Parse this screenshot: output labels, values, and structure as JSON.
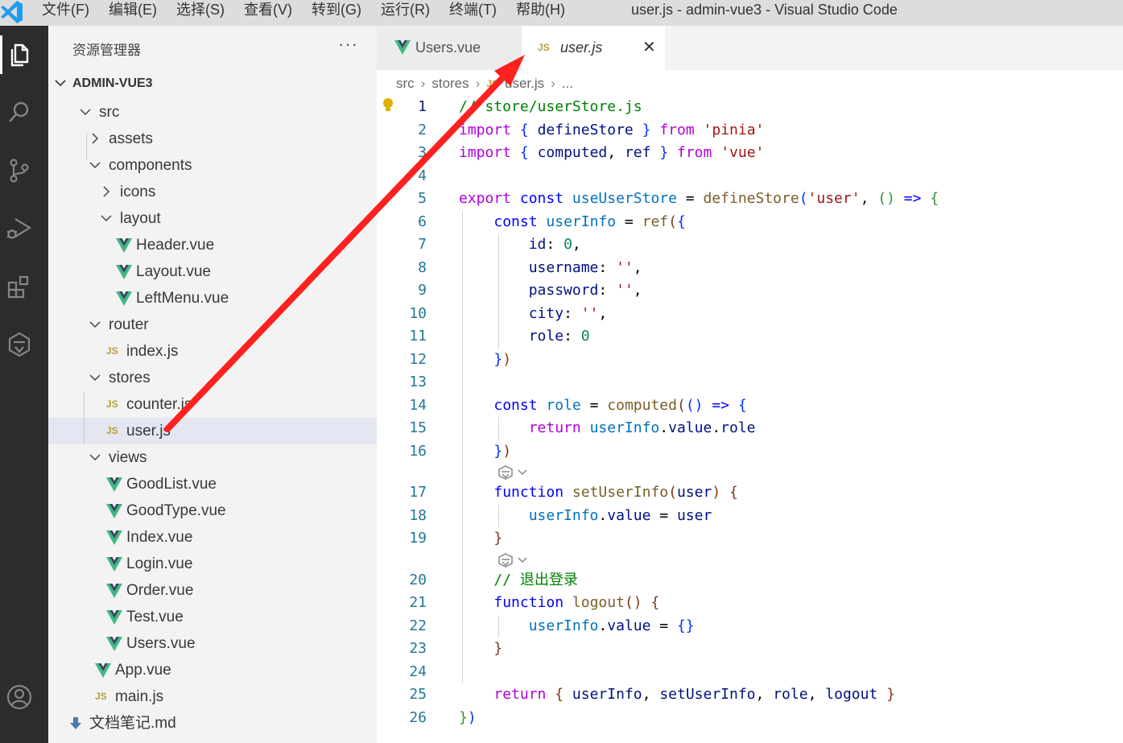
{
  "window": {
    "menu": [
      "文件(F)",
      "编辑(E)",
      "选择(S)",
      "查看(V)",
      "转到(G)",
      "运行(R)",
      "终端(T)",
      "帮助(H)"
    ],
    "title": "user.js - admin-vue3 - Visual Studio Code"
  },
  "activity_bar": {
    "items": [
      "explorer-icon",
      "search-icon",
      "source-control-icon",
      "run-debug-icon",
      "extensions-icon",
      "copilot-icon"
    ],
    "bottom": [
      "account-icon"
    ]
  },
  "sidebar": {
    "title": "资源管理器",
    "more": "···",
    "root": "ADMIN-VUE3",
    "tree": [
      {
        "label": "src",
        "kind": "folder-open",
        "depth": 0
      },
      {
        "label": "assets",
        "kind": "folder-closed",
        "depth": 1
      },
      {
        "label": "components",
        "kind": "folder-open",
        "depth": 1
      },
      {
        "label": "icons",
        "kind": "folder-closed",
        "depth": 2
      },
      {
        "label": "layout",
        "kind": "folder-open",
        "depth": 2
      },
      {
        "label": "Header.vue",
        "kind": "vue",
        "depth": 3
      },
      {
        "label": "Layout.vue",
        "kind": "vue",
        "depth": 3
      },
      {
        "label": "LeftMenu.vue",
        "kind": "vue",
        "depth": 3
      },
      {
        "label": "router",
        "kind": "folder-open",
        "depth": 1
      },
      {
        "label": "index.js",
        "kind": "js",
        "depth": 2
      },
      {
        "label": "stores",
        "kind": "folder-open",
        "depth": 1
      },
      {
        "label": "counter.js",
        "kind": "js",
        "depth": 2
      },
      {
        "label": "user.js",
        "kind": "js",
        "depth": 2,
        "selected": true
      },
      {
        "label": "views",
        "kind": "folder-open",
        "depth": 1
      },
      {
        "label": "GoodList.vue",
        "kind": "vue",
        "depth": 2
      },
      {
        "label": "GoodType.vue",
        "kind": "vue",
        "depth": 2
      },
      {
        "label": "Index.vue",
        "kind": "vue",
        "depth": 2
      },
      {
        "label": "Login.vue",
        "kind": "vue",
        "depth": 2
      },
      {
        "label": "Order.vue",
        "kind": "vue",
        "depth": 2
      },
      {
        "label": "Test.vue",
        "kind": "vue",
        "depth": 2
      },
      {
        "label": "Users.vue",
        "kind": "vue",
        "depth": 2
      },
      {
        "label": "App.vue",
        "kind": "vue",
        "depth": 1
      },
      {
        "label": "main.js",
        "kind": "js",
        "depth": 1
      },
      {
        "label": "文档笔记.md",
        "kind": "md",
        "depth": 0
      }
    ]
  },
  "editor": {
    "tabs": [
      {
        "label": "Users.vue",
        "icon": "vue-icon",
        "active": false
      },
      {
        "label": "user.js",
        "icon": "js-icon",
        "active": true,
        "close": "✕"
      }
    ],
    "breadcrumbs": [
      "src",
      "stores",
      "user.js",
      "..."
    ],
    "breadcrumb_sep": "›",
    "js_badge": "JS",
    "lines": [
      {
        "n": "1",
        "text": "// store/userStore.js",
        "tokens": [
          [
            "cm",
            "// store/userStore.js"
          ]
        ]
      },
      {
        "n": "2",
        "text": "import { defineStore } from 'pinia'",
        "tokens": [
          [
            "kwc",
            "import"
          ],
          [
            "pn",
            " "
          ],
          [
            "b1",
            "{"
          ],
          [
            "pn",
            " "
          ],
          [
            "vr",
            "defineStore"
          ],
          [
            "pn",
            " "
          ],
          [
            "b1",
            "}"
          ],
          [
            "pn",
            " "
          ],
          [
            "kwc",
            "from"
          ],
          [
            "pn",
            " "
          ],
          [
            "st",
            "'pinia'"
          ]
        ]
      },
      {
        "n": "3",
        "text": "import { computed, ref } from 'vue'",
        "tokens": [
          [
            "kwc",
            "import"
          ],
          [
            "pn",
            " "
          ],
          [
            "b1",
            "{"
          ],
          [
            "pn",
            " "
          ],
          [
            "vr",
            "computed"
          ],
          [
            "pn",
            ", "
          ],
          [
            "vr",
            "ref"
          ],
          [
            "pn",
            " "
          ],
          [
            "b1",
            "}"
          ],
          [
            "pn",
            " "
          ],
          [
            "kwc",
            "from"
          ],
          [
            "pn",
            " "
          ],
          [
            "st",
            "'vue'"
          ]
        ]
      },
      {
        "n": "4",
        "text": "",
        "tokens": []
      },
      {
        "n": "5",
        "text": "export const useUserStore = defineStore('user', () => {",
        "tokens": [
          [
            "kwc",
            "export"
          ],
          [
            "pn",
            " "
          ],
          [
            "kw",
            "const"
          ],
          [
            "pn",
            " "
          ],
          [
            "cv",
            "useUserStore"
          ],
          [
            "pn",
            " = "
          ],
          [
            "fn",
            "defineStore"
          ],
          [
            "b1",
            "("
          ],
          [
            "st",
            "'user'"
          ],
          [
            "pn",
            ", "
          ],
          [
            "b2",
            "()"
          ],
          [
            "pn",
            " "
          ],
          [
            "kw",
            "=>"
          ],
          [
            "pn",
            " "
          ],
          [
            "b2",
            "{"
          ]
        ]
      },
      {
        "n": "6",
        "text": "    const userInfo = ref({",
        "tokens": [
          [
            "pn",
            "    "
          ],
          [
            "kw",
            "const"
          ],
          [
            "pn",
            " "
          ],
          [
            "cv",
            "userInfo"
          ],
          [
            "pn",
            " = "
          ],
          [
            "fn",
            "ref"
          ],
          [
            "b3",
            "("
          ],
          [
            "b1",
            "{"
          ]
        ]
      },
      {
        "n": "7",
        "text": "        id: 0,",
        "tokens": [
          [
            "pn",
            "        "
          ],
          [
            "vr",
            "id"
          ],
          [
            "pn",
            ": "
          ],
          [
            "nm",
            "0"
          ],
          [
            "pn",
            ","
          ]
        ]
      },
      {
        "n": "8",
        "text": "        username: '',",
        "tokens": [
          [
            "pn",
            "        "
          ],
          [
            "vr",
            "username"
          ],
          [
            "pn",
            ": "
          ],
          [
            "st",
            "''"
          ],
          [
            "pn",
            ","
          ]
        ]
      },
      {
        "n": "9",
        "text": "        password: '',",
        "tokens": [
          [
            "pn",
            "        "
          ],
          [
            "vr",
            "password"
          ],
          [
            "pn",
            ": "
          ],
          [
            "st",
            "''"
          ],
          [
            "pn",
            ","
          ]
        ]
      },
      {
        "n": "10",
        "text": "        city: '',",
        "tokens": [
          [
            "pn",
            "        "
          ],
          [
            "vr",
            "city"
          ],
          [
            "pn",
            ": "
          ],
          [
            "st",
            "''"
          ],
          [
            "pn",
            ","
          ]
        ]
      },
      {
        "n": "11",
        "text": "        role: 0",
        "tokens": [
          [
            "pn",
            "        "
          ],
          [
            "vr",
            "role"
          ],
          [
            "pn",
            ": "
          ],
          [
            "nm",
            "0"
          ]
        ]
      },
      {
        "n": "12",
        "text": "    })",
        "tokens": [
          [
            "pn",
            "    "
          ],
          [
            "b1",
            "}"
          ],
          [
            "b3",
            ")"
          ]
        ]
      },
      {
        "n": "13",
        "text": "",
        "tokens": []
      },
      {
        "n": "14",
        "text": "    const role = computed(() => {",
        "tokens": [
          [
            "pn",
            "    "
          ],
          [
            "kw",
            "const"
          ],
          [
            "pn",
            " "
          ],
          [
            "cv",
            "role"
          ],
          [
            "pn",
            " = "
          ],
          [
            "fn",
            "computed"
          ],
          [
            "b3",
            "("
          ],
          [
            "b1",
            "()"
          ],
          [
            "pn",
            " "
          ],
          [
            "kw",
            "=>"
          ],
          [
            "pn",
            " "
          ],
          [
            "b1",
            "{"
          ]
        ]
      },
      {
        "n": "15",
        "text": "        return userInfo.value.role",
        "tokens": [
          [
            "pn",
            "        "
          ],
          [
            "kwc",
            "return"
          ],
          [
            "pn",
            " "
          ],
          [
            "cv",
            "userInfo"
          ],
          [
            "pn",
            "."
          ],
          [
            "vr",
            "value"
          ],
          [
            "pn",
            "."
          ],
          [
            "vr",
            "role"
          ]
        ]
      },
      {
        "n": "16",
        "text": "    })",
        "tokens": [
          [
            "pn",
            "    "
          ],
          [
            "b1",
            "}"
          ],
          [
            "b3",
            ")"
          ]
        ]
      },
      {
        "n": "",
        "text": "",
        "tokens": [],
        "lens": true
      },
      {
        "n": "17",
        "text": "    function setUserInfo(user) {",
        "tokens": [
          [
            "pn",
            "    "
          ],
          [
            "kw",
            "function"
          ],
          [
            "pn",
            " "
          ],
          [
            "fn",
            "setUserInfo"
          ],
          [
            "b3",
            "("
          ],
          [
            "vr",
            "user"
          ],
          [
            "b3",
            ")"
          ],
          [
            "pn",
            " "
          ],
          [
            "b3",
            "{"
          ]
        ]
      },
      {
        "n": "18",
        "text": "        userInfo.value = user",
        "tokens": [
          [
            "pn",
            "        "
          ],
          [
            "cv",
            "userInfo"
          ],
          [
            "pn",
            "."
          ],
          [
            "vr",
            "value"
          ],
          [
            "pn",
            " = "
          ],
          [
            "vr",
            "user"
          ]
        ]
      },
      {
        "n": "19",
        "text": "    }",
        "tokens": [
          [
            "pn",
            "    "
          ],
          [
            "b3",
            "}"
          ]
        ]
      },
      {
        "n": "",
        "text": "",
        "tokens": [],
        "lens": true
      },
      {
        "n": "20",
        "text": "    // 退出登录",
        "tokens": [
          [
            "pn",
            "    "
          ],
          [
            "cm",
            "// 退出登录"
          ]
        ]
      },
      {
        "n": "21",
        "text": "    function logout() {",
        "tokens": [
          [
            "pn",
            "    "
          ],
          [
            "kw",
            "function"
          ],
          [
            "pn",
            " "
          ],
          [
            "fn",
            "logout"
          ],
          [
            "b3",
            "()"
          ],
          [
            "pn",
            " "
          ],
          [
            "b3",
            "{"
          ]
        ]
      },
      {
        "n": "22",
        "text": "        userInfo.value = {}",
        "tokens": [
          [
            "pn",
            "        "
          ],
          [
            "cv",
            "userInfo"
          ],
          [
            "pn",
            "."
          ],
          [
            "vr",
            "value"
          ],
          [
            "pn",
            " = "
          ],
          [
            "b1",
            "{}"
          ]
        ]
      },
      {
        "n": "23",
        "text": "    }",
        "tokens": [
          [
            "pn",
            "    "
          ],
          [
            "b3",
            "}"
          ]
        ]
      },
      {
        "n": "24",
        "text": "",
        "tokens": []
      },
      {
        "n": "25",
        "text": "    return { userInfo, setUserInfo, role, logout }",
        "tokens": [
          [
            "pn",
            "    "
          ],
          [
            "kwc",
            "return"
          ],
          [
            "pn",
            " "
          ],
          [
            "b3",
            "{"
          ],
          [
            "pn",
            " "
          ],
          [
            "vr",
            "userInfo"
          ],
          [
            "pn",
            ", "
          ],
          [
            "vr",
            "setUserInfo"
          ],
          [
            "pn",
            ", "
          ],
          [
            "vr",
            "role"
          ],
          [
            "pn",
            ", "
          ],
          [
            "vr",
            "logout"
          ],
          [
            "pn",
            " "
          ],
          [
            "b3",
            "}"
          ]
        ]
      },
      {
        "n": "26",
        "text": "})",
        "tokens": [
          [
            "b2",
            "}"
          ],
          [
            "b1",
            ")"
          ]
        ]
      }
    ]
  },
  "annotation": {
    "type": "red-arrow",
    "color": "#ff2020",
    "from": "sidebar user.js",
    "to": "user.js tab"
  },
  "colors": {
    "activity_bg": "#2c2c2c",
    "sidebar_bg": "#f3f3f3",
    "selection": "#e4e6f1",
    "vue_green": "#41b883",
    "js_yellow": "#b7a03a",
    "vscode_blue": "#1f9cf0"
  }
}
